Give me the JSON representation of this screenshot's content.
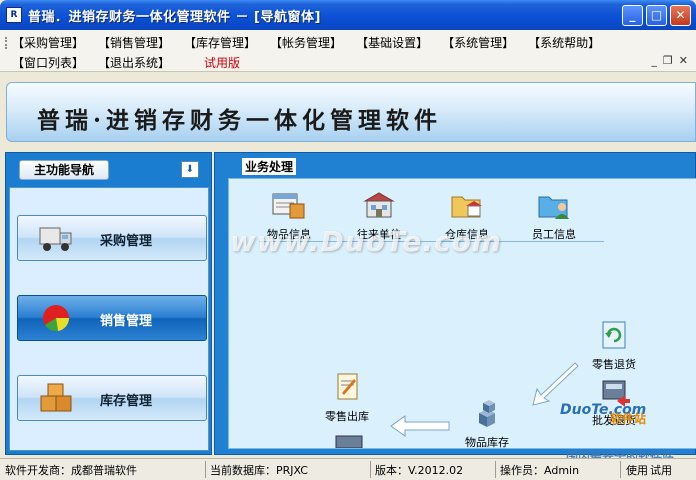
{
  "window": {
    "title": "普瑞．进销存财务一体化管理软件 － [导航窗体]",
    "app_icon": "app-logo-icon",
    "minimize": "_",
    "maximize": "□",
    "close": "✕"
  },
  "menu": {
    "row1": [
      "【采购管理】",
      "【销售管理】",
      "【库存管理】",
      "【帐务管理】",
      "【基础设置】",
      "【系统管理】",
      "【系统帮助】"
    ],
    "row2": [
      "【窗口列表】",
      "【退出系统】"
    ],
    "trial": "试用版",
    "mdi": {
      "minimize": "_",
      "restore": "❐",
      "close": "✕"
    }
  },
  "banner": {
    "title": "普瑞·进销存财务一体化管理软件"
  },
  "nav": {
    "header": "主功能导航",
    "arrow": "⬇",
    "items": [
      {
        "label": "采购管理",
        "icon": "truck-icon",
        "active": false
      },
      {
        "label": "销售管理",
        "icon": "pie-chart-icon",
        "active": true
      },
      {
        "label": "库存管理",
        "icon": "boxes-icon",
        "active": false
      }
    ]
  },
  "workspace": {
    "title": "业务处理",
    "tools": [
      {
        "label": "物品信息",
        "icon": "goods-info-icon"
      },
      {
        "label": "往来单位",
        "icon": "partner-unit-icon"
      },
      {
        "label": "仓库信息",
        "icon": "warehouse-folder-icon"
      },
      {
        "label": "员工信息",
        "icon": "employee-folder-icon"
      },
      {
        "label": "零售退货",
        "icon": "retail-return-icon"
      },
      {
        "label": "批发退货",
        "icon": "wholesale-return-icon"
      },
      {
        "label": "物品库存",
        "icon": "cubes-icon"
      },
      {
        "label": "零售出库",
        "icon": "retail-out-icon"
      }
    ]
  },
  "watermark": {
    "text": "www.DuoTe.com",
    "site": "DuoTe.com",
    "badge": "软件站",
    "sub": "国内最安全的软件站"
  },
  "status": {
    "developer": "软件开发商：成都普瑞软件",
    "database": "当前数据库：PRJXC",
    "version": "版本：V.2012.02",
    "operator": "操作员：Admin",
    "usage": "使用",
    "trial": "试用"
  },
  "colors": {
    "titlebar": "#0a4fd6",
    "panel": "#1b7dd0",
    "workspace": "#daf0fc",
    "trial_red": "#d0000a"
  }
}
